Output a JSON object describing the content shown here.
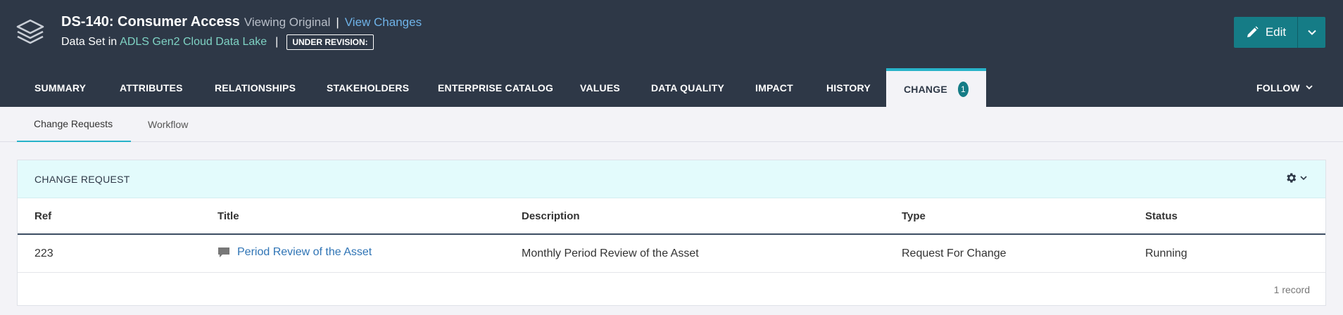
{
  "header": {
    "asset_title": "DS-140: Consumer Access",
    "viewing": "Viewing Original",
    "separator": "|",
    "view_changes": "View Changes",
    "subtitle_prefix": "Data Set in",
    "subtitle_link": "ADLS Gen2 Cloud Data Lake",
    "pipe": "|",
    "revision_badge": "UNDER REVISION:",
    "edit_label": "Edit",
    "logo_icon": "layers-icon",
    "colors": {
      "bg": "#2e3847",
      "accent": "#157c86",
      "link": "#6fb3e8",
      "tab_highlight": "#27b3c9"
    }
  },
  "tabs": [
    {
      "label": "SUMMARY"
    },
    {
      "label": "ATTRIBUTES"
    },
    {
      "label": "RELATIONSHIPS"
    },
    {
      "label": "STAKEHOLDERS"
    },
    {
      "label": "ENTERPRISE CATALOG"
    },
    {
      "label": "VALUES"
    },
    {
      "label": "DATA QUALITY"
    },
    {
      "label": "IMPACT"
    },
    {
      "label": "HISTORY"
    },
    {
      "label": "CHANGE",
      "count": "1",
      "active": true
    }
  ],
  "follow_label": "FOLLOW",
  "subtabs": [
    {
      "label": "Change Requests",
      "active": true
    },
    {
      "label": "Workflow"
    }
  ],
  "panel": {
    "title": "CHANGE REQUEST",
    "columns": [
      "Ref",
      "Title",
      "Description",
      "Type",
      "Status"
    ],
    "rows": [
      {
        "ref": "223",
        "title": "Period Review of the Asset",
        "description": "Monthly Period Review of the Asset",
        "type": "Request For Change",
        "status": "Running"
      }
    ],
    "record_count": "1 record"
  }
}
